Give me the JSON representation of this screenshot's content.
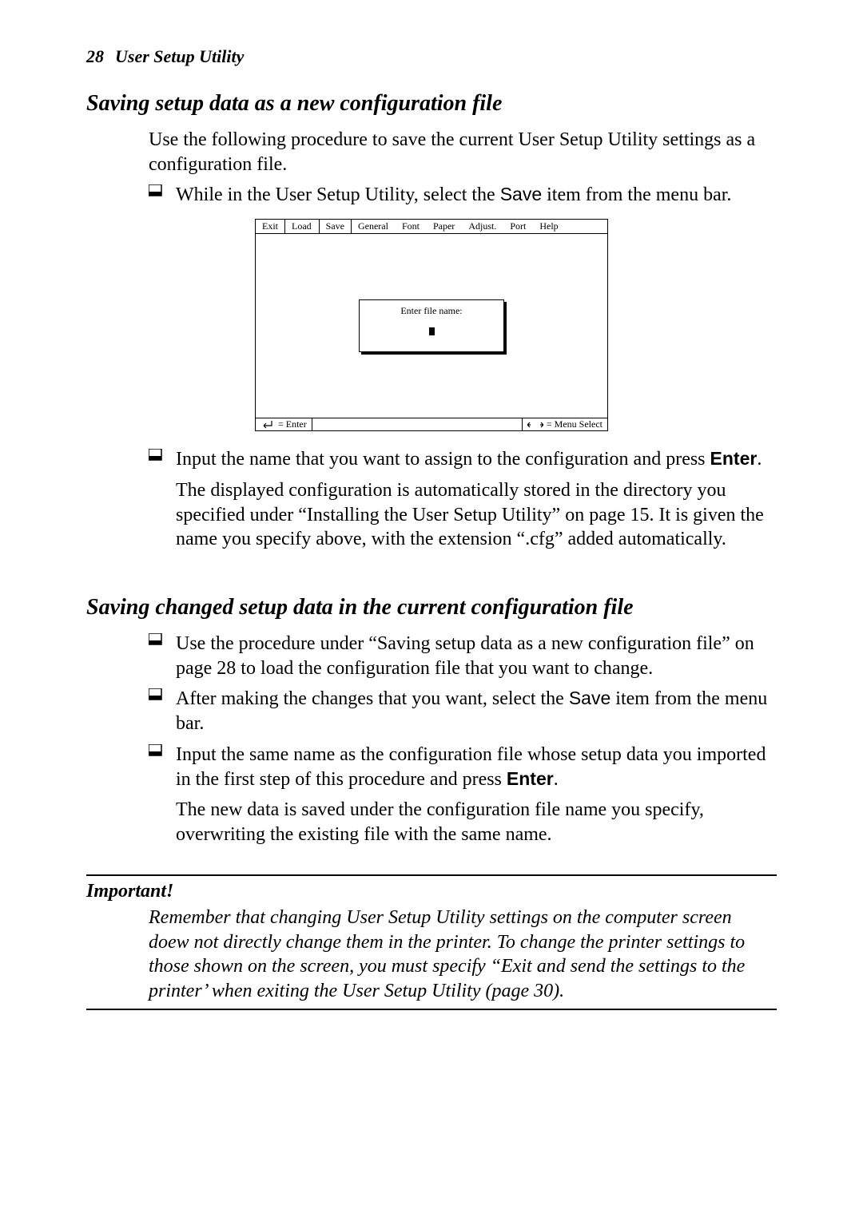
{
  "header": {
    "page_number": "28",
    "chapter": "User Setup Utility"
  },
  "section1": {
    "heading": "Saving setup data as a new configuration file",
    "intro": "Use the following procedure to save the current User Setup Utility settings as a configuration file.",
    "bullet1_pre": "While in the User Setup Utility, select the ",
    "bullet1_save": "Save",
    "bullet1_post": " item from the menu bar.",
    "bullet2_pre": "Input the name that you want to assign to the configuration and press ",
    "bullet2_enter": "Enter",
    "bullet2_post": ".",
    "follow1": "The displayed configuration is automatically stored in the directory you specified under “Installing the User Setup Utility” on page 15. It is given the name you specify above, with the extension “.cfg” added automatically."
  },
  "screenshot": {
    "menu": [
      "Exit",
      "Load",
      "Save",
      "General",
      "Font",
      "Paper",
      "Adjust.",
      "Port",
      "Help"
    ],
    "dialog_prompt": "Enter file name:",
    "status_left": "= Enter",
    "status_right": "= Menu Select"
  },
  "section2": {
    "heading": "Saving changed setup data in the current configuration file",
    "b1": "Use the procedure under “Saving setup data as a new configuration file” on page 28 to load the configuration file that you want to change.",
    "b2_pre": "After making the changes that you want, select the ",
    "b2_save": "Save",
    "b2_post": " item from the menu bar.",
    "b3_pre": "Input the same name as the configuration file whose setup data you imported in the first step of this procedure and press ",
    "b3_enter": "Enter",
    "b3_post": ".",
    "follow": "The new data is saved under the configuration file name you specify, overwriting the existing file with the same name."
  },
  "important": {
    "label": "Important!",
    "body": "Remember that changing User Setup Utility settings on the computer screen doew not directly change them in the printer. To change the printer settings to those shown on the screen, you must specify “Exit and send the settings to the printer’ when exiting the User Setup Utility (page 30)."
  }
}
